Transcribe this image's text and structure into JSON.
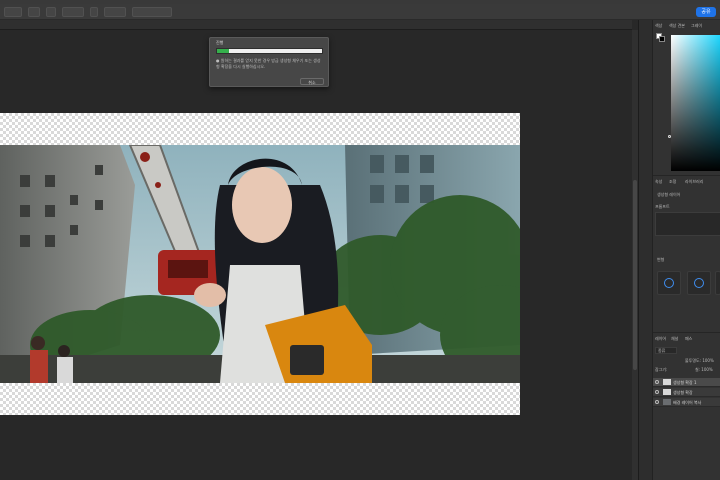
{
  "toolbar": {
    "share_label": "공유"
  },
  "dialog": {
    "title": "진행",
    "progress_percent": 11,
    "message": "● 원하는 결과를 얻지 못한 경우 방금 생성형 채우기 또는 생성형 확장을 다시 실행하십시오.",
    "cancel_label": "취소"
  },
  "panels": {
    "color_tabs": [
      "색상",
      "색상 견본",
      "그레이"
    ],
    "properties_tabs": [
      "속성",
      "조정",
      "라이브러리"
    ],
    "properties_item": "생성형 레이어",
    "properties_caption": "프롬프트",
    "presets_caption": "변형",
    "layers_tabs": [
      "레이어",
      "채널",
      "패스"
    ],
    "layers_filter": "종류",
    "layer_opacity": "불투명도: 100%",
    "layer_lock": "잠그기:",
    "layer_fill": "칠: 100%"
  },
  "layers": [
    {
      "name": "생성형 확장 1",
      "selected": true
    },
    {
      "name": "생성형 확장",
      "selected": false
    },
    {
      "name": "배경 레이어 복사",
      "selected": false
    }
  ],
  "colors": {
    "accent": "#1f73e8",
    "progress": "#35b04c",
    "panel_bg": "#323232",
    "canvas_bg": "#282828"
  }
}
